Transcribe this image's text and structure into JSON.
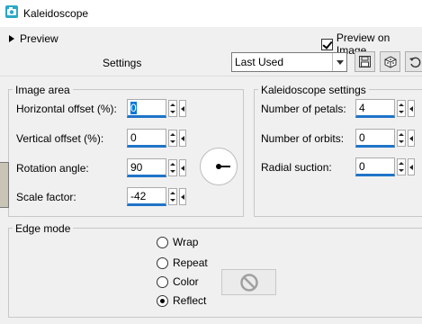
{
  "window": {
    "title": "Kaleidoscope"
  },
  "top": {
    "preview_toggle_label": "Preview",
    "preview_on_image_label": "Preview on Image",
    "preview_on_image_checked": true
  },
  "settings": {
    "label": "Settings",
    "selected": "Last Used"
  },
  "toolbar": {
    "icons": [
      "save-icon",
      "randomize-icon",
      "reset-icon"
    ]
  },
  "image_area": {
    "title": "Image area",
    "horizontal_offset": {
      "label": "Horizontal offset (%):",
      "value": "0"
    },
    "vertical_offset": {
      "label": "Vertical offset (%):",
      "value": "0"
    },
    "rotation_angle": {
      "label": "Rotation angle:",
      "value": "90"
    },
    "scale_factor": {
      "label": "Scale factor:",
      "value": "-42"
    }
  },
  "kaleidoscope_settings": {
    "title": "Kaleidoscope settings",
    "number_of_petals": {
      "label": "Number of petals:",
      "value": "4"
    },
    "number_of_orbits": {
      "label": "Number of orbits:",
      "value": "0"
    },
    "radial_suction": {
      "label": "Radial suction:",
      "value": "0"
    }
  },
  "edge_mode": {
    "title": "Edge mode",
    "options": [
      "Wrap",
      "Repeat",
      "Color",
      "Reflect"
    ],
    "selected": "Reflect"
  },
  "colors": {
    "accent": "#1f74c8",
    "selection": "#0078d7",
    "background": "#f0f0f0"
  }
}
